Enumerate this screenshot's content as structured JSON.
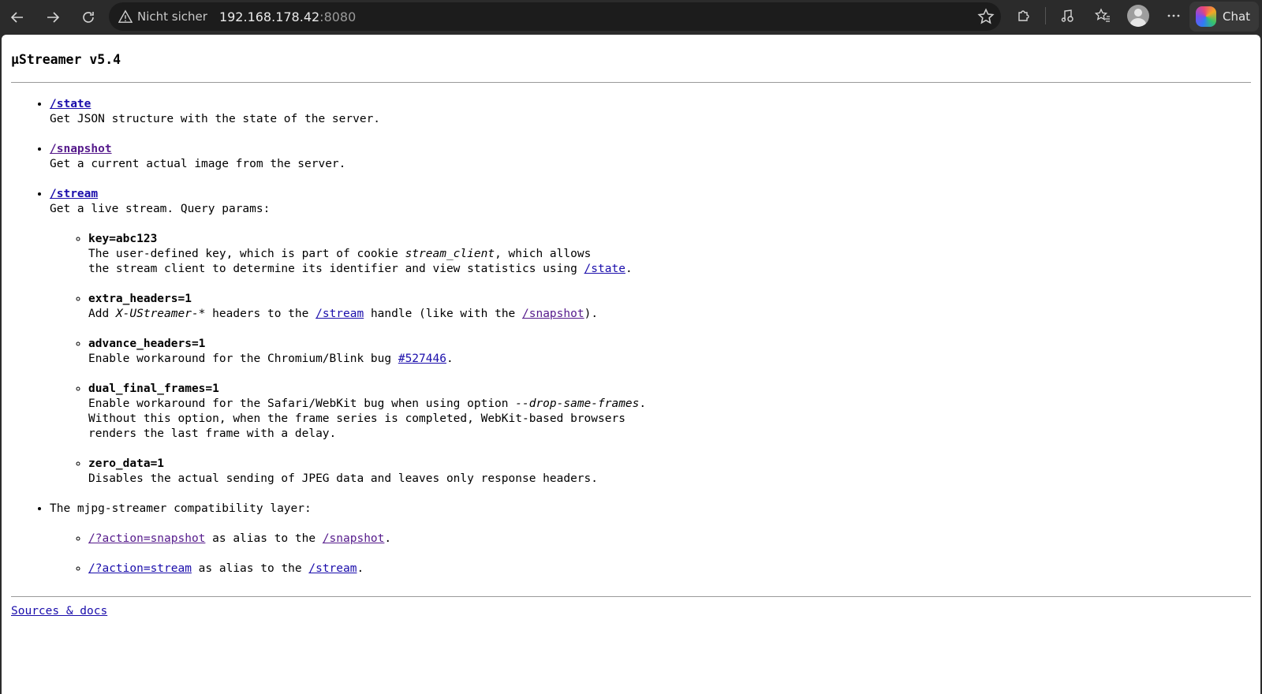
{
  "browser": {
    "security_label": "Nicht sicher",
    "url_host": "192.168.178.42",
    "url_port": ":8080",
    "chat_label": "Chat"
  },
  "page": {
    "title": "µStreamer v5.4",
    "state": {
      "link": "/state",
      "desc": "Get JSON structure with the state of the server."
    },
    "snapshot": {
      "link": "/snapshot",
      "desc": "Get a current actual image from the server."
    },
    "stream": {
      "link": "/stream",
      "desc": "Get a live stream. Query params:",
      "params": {
        "key": {
          "name": "key=abc123",
          "t1": "The user-defined key, which is part of cookie ",
          "em": "stream_client",
          "t2": ", which allows",
          "t3": "the stream client to determine its identifier and view statistics using ",
          "link": "/state",
          "t4": "."
        },
        "extra": {
          "name": "extra_headers=1",
          "t1": "Add ",
          "em": "X-UStreamer-*",
          "t2": " headers to the ",
          "link1": "/stream",
          "t3": " handle (like with the ",
          "link2": "/snapshot",
          "t4": ")."
        },
        "advance": {
          "name": "advance_headers=1",
          "t1": "Enable workaround for the Chromium/Blink bug ",
          "link": "#527446",
          "t2": "."
        },
        "dual": {
          "name": "dual_final_frames=1",
          "t1": "Enable workaround for the Safari/WebKit bug when using option ",
          "em": "--drop-same-frames",
          "t2": ".",
          "line2": "Without this option, when the frame series is completed, WebKit-based browsers",
          "line3": "renders the last frame with a delay."
        },
        "zero": {
          "name": "zero_data=1",
          "desc": "Disables the actual sending of JPEG data and leaves only response headers."
        }
      }
    },
    "compat": {
      "label": "The mjpg-streamer compatibility layer:",
      "items": [
        {
          "link": "/?action=snapshot",
          "mid": " as alias to the ",
          "target": "/snapshot",
          "end": "."
        },
        {
          "link": "/?action=stream",
          "mid": " as alias to the ",
          "target": "/stream",
          "end": "."
        }
      ]
    },
    "footer_link": "Sources & docs"
  }
}
